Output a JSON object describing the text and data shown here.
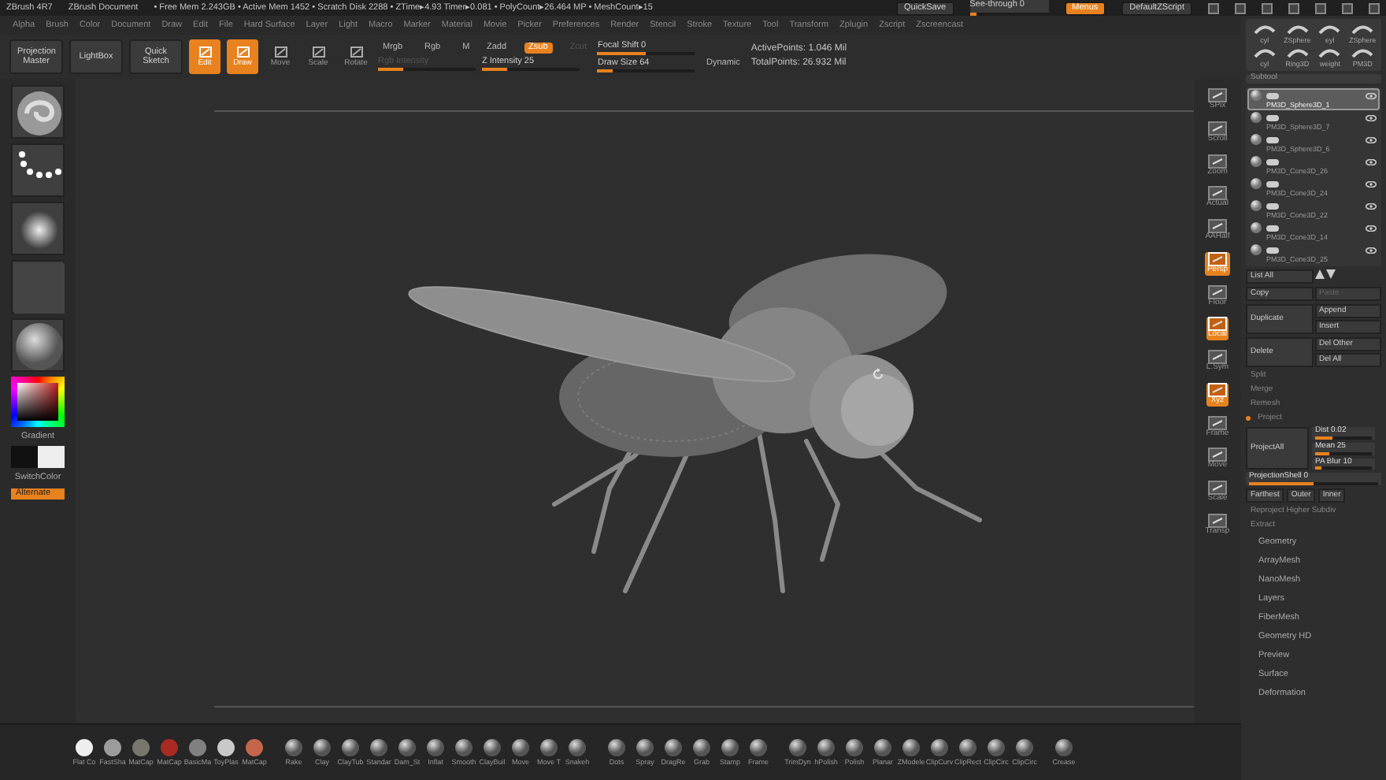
{
  "title_bar": {
    "app": "ZBrush 4R7",
    "document": "ZBrush Document",
    "stats": "• Free Mem 2.243GB • Active Mem 1452 • Scratch Disk 2288 • ZTime▸4.93 Timer▸0.081 • PolyCount▸26.464 MP • MeshCount▸15",
    "controls": [
      {
        "kind": "button",
        "label": "QuickSave",
        "highlighted": false
      },
      {
        "kind": "slider",
        "label": "See-through   0",
        "level": 0
      },
      {
        "kind": "button",
        "label": "Menus",
        "highlighted": true
      },
      {
        "kind": "button",
        "label": "DefaultZScript",
        "highlighted": false
      }
    ]
  },
  "menu_bar": [
    "Alpha",
    "Brush",
    "Color",
    "Document",
    "Draw",
    "Edit",
    "File",
    "Hard Surface",
    "Layer",
    "Light",
    "Macro",
    "Marker",
    "Material",
    "Movie",
    "Picker",
    "Preferences",
    "Render",
    "Stencil",
    "Stroke",
    "Texture",
    "Tool",
    "Transform",
    "Zplugin",
    "Zscript",
    "Zscreencast"
  ],
  "toolbar": [
    {
      "items": [
        {
          "kind": "button",
          "label": "Projection Master"
        }
      ]
    },
    {
      "items": [
        {
          "kind": "button",
          "label": "LightBox"
        }
      ]
    },
    {
      "items": [
        {
          "kind": "button",
          "label": "Quick Sketch"
        }
      ]
    },
    {
      "items": [
        {
          "kind": "mode",
          "label": "Edit",
          "active": true
        }
      ]
    },
    {
      "items": [
        {
          "kind": "mode",
          "label": "Draw",
          "active": true
        }
      ]
    },
    {
      "items": [
        {
          "kind": "mode",
          "label": "Move",
          "active": false
        }
      ]
    },
    {
      "items": [
        {
          "kind": "mode",
          "label": "Scale",
          "active": false
        }
      ]
    },
    {
      "items": [
        {
          "kind": "mode",
          "label": "Rotate",
          "active": false
        }
      ]
    },
    {
      "items": [
        {
          "kind": "toggles",
          "toggles": [
            {
              "label": "Mrgb",
              "active": false,
              "disabled": false
            },
            {
              "label": "Rgb",
              "active": false,
              "disabled": false
            },
            {
              "label": "M",
              "active": false,
              "disabled": false
            }
          ]
        },
        {
          "kind": "slider",
          "label": "Rgb Intensity",
          "level": 0.25,
          "disabled": true
        }
      ]
    },
    {
      "items": [
        {
          "kind": "toggles",
          "toggles": [
            {
              "label": "Zadd",
              "active": false,
              "disabled": false
            },
            {
              "label": "Zsub",
              "active": true,
              "disabled": false
            },
            {
              "label": "Zcut",
              "active": false,
              "disabled": true
            }
          ]
        },
        {
          "kind": "slider",
          "label": "Z Intensity 25",
          "level": 0.25,
          "disabled": false
        }
      ]
    },
    {
      "items": [
        {
          "kind": "slider",
          "label": "Focal Shift 0",
          "level": 0.5,
          "disabled": false
        },
        {
          "kind": "slider",
          "label": "Draw Size 64",
          "level": 0.15,
          "disabled": false,
          "button": "Dynamic"
        }
      ]
    },
    {
      "items": [
        {
          "kind": "stat",
          "label": "ActivePoints: 1.046 Mil"
        },
        {
          "kind": "stat",
          "label": "TotalPoints: 26.932 Mil"
        }
      ]
    }
  ],
  "left_shelf": {
    "gradient_label": "Gradient",
    "switch_label": "SwitchColor",
    "alternate_label": "Alternate"
  },
  "view_tools": [
    {
      "label": "SPix",
      "active": false
    },
    {
      "label": "Scroll",
      "active": false
    },
    {
      "label": "Zoom",
      "active": false
    },
    {
      "label": "Actual",
      "active": false
    },
    {
      "label": "AAHalf",
      "active": false
    },
    {
      "label": "Persp",
      "active": true
    },
    {
      "label": "Floor",
      "active": false
    },
    {
      "label": "Local",
      "active": true
    },
    {
      "label": "L.Sym",
      "active": false
    },
    {
      "label": "Xyz",
      "active": true
    },
    {
      "label": "Frame",
      "active": false
    },
    {
      "label": "Move",
      "active": false
    },
    {
      "label": "Scale",
      "active": false
    },
    {
      "label": "Transp",
      "active": false
    }
  ],
  "right_panel": {
    "tool_thumbs": [
      "cyl",
      "ZSphere",
      "eyl",
      "ZSphere",
      "cyl",
      "Ring3D",
      "weight",
      "PM3D"
    ],
    "subtool_title": "Subtool",
    "subtools": [
      {
        "name": "PM3D_Sphere3D_1",
        "selected": true
      },
      {
        "name": "PM3D_Sphere3D_7",
        "selected": false
      },
      {
        "name": "PM3D_Sphere3D_6",
        "selected": false
      },
      {
        "name": "PM3D_Cone3D_26",
        "selected": false
      },
      {
        "name": "PM3D_Cone3D_24",
        "selected": false
      },
      {
        "name": "PM3D_Cone3D_22",
        "selected": false
      },
      {
        "name": "PM3D_Cone3D_14",
        "selected": false
      },
      {
        "name": "PM3D_Cone3D_25",
        "selected": false
      }
    ],
    "list_all": "List All",
    "action_rows": [
      {
        "main": "Copy",
        "side": [
          {
            "label": "Paste",
            "disabled": true
          }
        ]
      },
      {
        "main": "Duplicate",
        "side": [
          {
            "label": "Append",
            "disabled": false
          },
          {
            "label": "Insert",
            "disabled": false
          }
        ]
      },
      {
        "main": "Delete",
        "side": [
          {
            "label": "Del Other",
            "disabled": false
          },
          {
            "label": "Del All",
            "disabled": false
          }
        ]
      }
    ],
    "sections": [
      "Split",
      "Merge",
      "Remesh"
    ],
    "project": {
      "header": "Project",
      "button": "ProjectAll",
      "sliders": [
        {
          "label": "Dist 0.02",
          "level": 0.3
        },
        {
          "label": "Mean 25",
          "level": 0.25
        },
        {
          "label": "PA Blur 10",
          "level": 0.1
        }
      ],
      "shell": {
        "label": "ProjectionShell 0",
        "level": 0.5
      },
      "options": [
        "Farthest",
        "Outer",
        "Inner"
      ],
      "reproject": "Reproject Higher Subdiv",
      "extract": "Extract"
    },
    "palettes": [
      "Geometry",
      "ArrayMesh",
      "NanoMesh",
      "Layers",
      "FiberMesh",
      "Geometry HD",
      "Preview",
      "Surface",
      "Deformation"
    ]
  },
  "bottom_shelf": {
    "materials": [
      {
        "label": "Flat Co",
        "color": "#eeeeee"
      },
      {
        "label": "FastSha",
        "color": "#9c9c9c"
      },
      {
        "label": "MatCap",
        "color": "#77776e"
      },
      {
        "label": "MatCap",
        "color": "#a82a22"
      },
      {
        "label": "BasicMa",
        "color": "#808080"
      },
      {
        "label": "ToyPlas",
        "color": "#c9c9c9"
      },
      {
        "label": "MatCap",
        "color": "#c5664c"
      }
    ],
    "brushes": [
      "Rake",
      "Clay",
      "ClayTub",
      "Standar",
      "Dam_St",
      "Inflat",
      "Smooth",
      "ClayBuil",
      "Move",
      "Move T",
      "Snakeh"
    ],
    "strokes": [
      "Dots",
      "Spray",
      "DragRe",
      "Grab",
      "Stamp",
      "Frame"
    ],
    "brushes_2": [
      "TrimDyn",
      "hPolish",
      "Polish",
      "Planar",
      "ZModele",
      "ClipCurv",
      "ClipRect",
      "ClipCirc",
      "ClipCirc"
    ],
    "last": "Crease"
  }
}
